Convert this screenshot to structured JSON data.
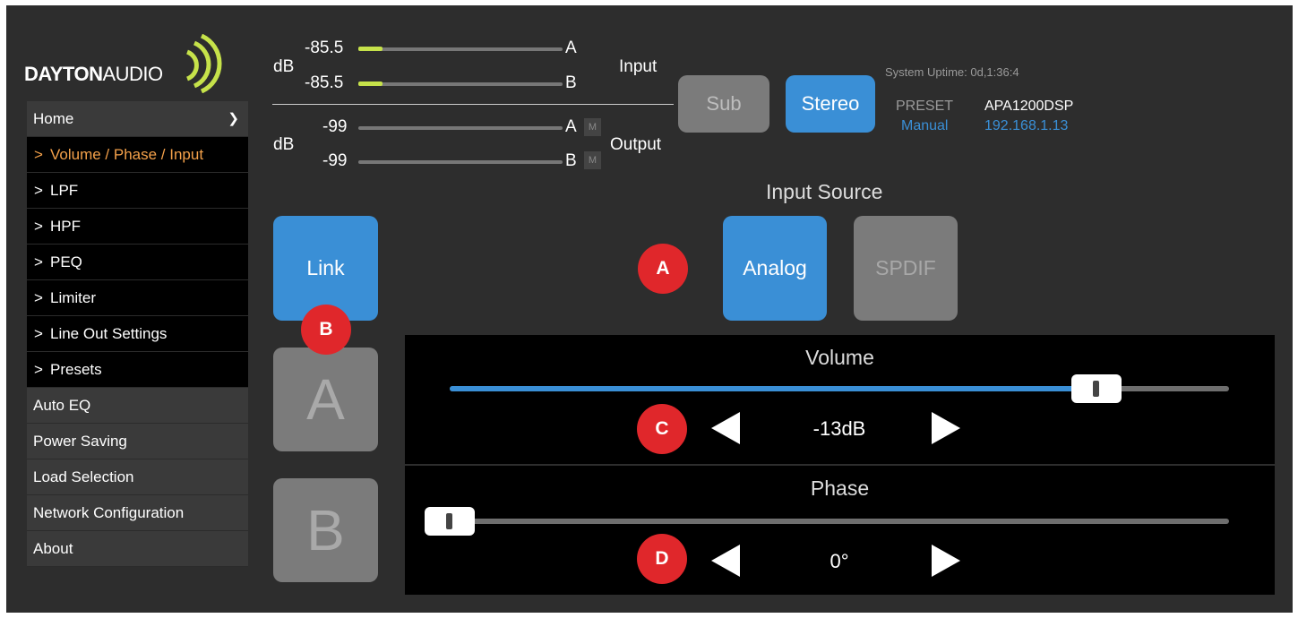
{
  "brand": {
    "logo_bold": "DAYTON",
    "logo_light": "AUDIO"
  },
  "sidebar": {
    "home": {
      "label": "Home",
      "caret": "chevron-down"
    },
    "sub_items": [
      {
        "label": "Volume / Phase / Input",
        "active": true
      },
      {
        "label": "LPF"
      },
      {
        "label": "HPF"
      },
      {
        "label": "PEQ"
      },
      {
        "label": "Limiter"
      },
      {
        "label": "Line Out Settings"
      },
      {
        "label": "Presets"
      }
    ],
    "main_items": [
      {
        "label": "Auto EQ"
      },
      {
        "label": "Power Saving"
      },
      {
        "label": "Load Selection"
      },
      {
        "label": "Network Configuration"
      },
      {
        "label": "About"
      }
    ],
    "chevron": ">"
  },
  "meters": {
    "input": {
      "unit": "dB",
      "label": "Input",
      "channels": [
        {
          "value": "-85.5",
          "name": "A",
          "level": 0.12
        },
        {
          "value": "-85.5",
          "name": "B",
          "level": 0.12
        }
      ]
    },
    "output": {
      "unit": "dB",
      "label": "Output",
      "mute_label": "M",
      "channels": [
        {
          "value": "-99",
          "name": "A",
          "level": 0
        },
        {
          "value": "-99",
          "name": "B",
          "level": 0
        }
      ]
    }
  },
  "mode_buttons": {
    "sub": "Sub",
    "stereo": "Stereo"
  },
  "system": {
    "uptime": "System Uptime: 0d,1:36:4",
    "preset_label": "PRESET",
    "model": "APA1200DSP",
    "preset_value": "Manual",
    "ip": "192.168.1.13"
  },
  "input_source": {
    "title": "Input Source",
    "analog": "Analog",
    "spdif": "SPDIF"
  },
  "channel_buttons": {
    "link": "Link",
    "a": "A",
    "b": "B"
  },
  "callouts": {
    "a": "A",
    "b": "B",
    "c": "C",
    "d": "D"
  },
  "volume": {
    "title": "Volume",
    "value": "-13dB",
    "level": 0.83
  },
  "phase": {
    "title": "Phase",
    "value": "0°",
    "level": 0
  },
  "colors": {
    "accent_blue": "#3a8fd6",
    "active_nav": "#f4a14a",
    "meter_fill": "#c6e24a",
    "callout_red": "#e0272b"
  }
}
